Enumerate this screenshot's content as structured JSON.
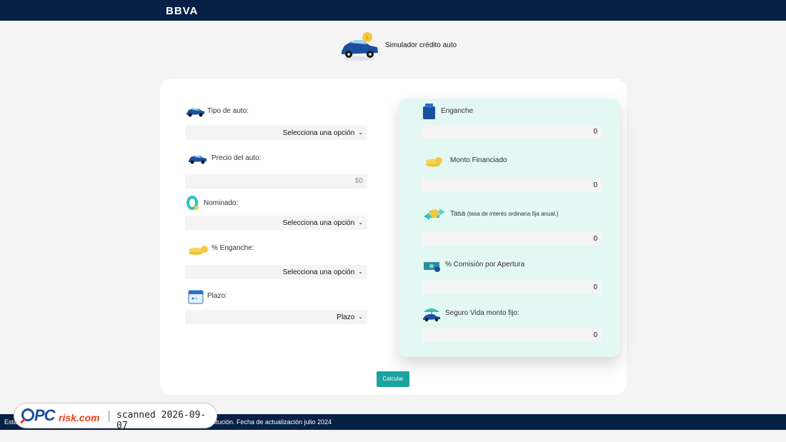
{
  "header": {
    "brand": "BBVA"
  },
  "hero": {
    "title": "Simulador crédito auto",
    "icon": "car-with-coin-icon"
  },
  "form": {
    "tipo_auto": {
      "label": "Tipo de auto:",
      "value": "Selecciona una opción",
      "icon": "cars-icon"
    },
    "precio": {
      "label": "Precio del auto:",
      "placeholder": "$0",
      "icon": "car-icon"
    },
    "nominado": {
      "label": "Nominado:",
      "value": "Selecciona una opción",
      "icon": "nominated-icon"
    },
    "enganche_pct": {
      "label": "% Enganche:",
      "value": "Selecciona una opción",
      "icon": "coins-icon"
    },
    "plazo": {
      "label": "Plazo:",
      "value": "Plazo",
      "icon": "calendar-icon"
    }
  },
  "results": {
    "enganche": {
      "label": "Enganche",
      "value": "0",
      "icon": "wallet-icon"
    },
    "monto": {
      "label": "Monto Financiado",
      "value": "0",
      "icon": "coins-stack-icon"
    },
    "tasa": {
      "label": "Tasa",
      "note": "(tasa de interés ordinaria fija anual.)",
      "value": "0",
      "icon": "exchange-coin-icon"
    },
    "comision": {
      "label": "% Comisión por Apertura",
      "value": "0",
      "icon": "cash-icon"
    },
    "seguro": {
      "label": "Seguro Vida monto fijo:",
      "value": "0",
      "icon": "car-umbrella-icon"
    }
  },
  "calc_button": "Calcular",
  "footer": {
    "prefix": "Esta",
    "suffix": "itución. Fecha de actualización julio 2024"
  },
  "watermark": {
    "brand_pc": "PC",
    "brand_risk": "risk.com",
    "scan_text": "scanned 2026-09-07"
  },
  "colors": {
    "navy": "#072146",
    "teal": "#1aa3a0",
    "mint": "#e3f7f3",
    "field_bg": "#f4f4f4"
  }
}
